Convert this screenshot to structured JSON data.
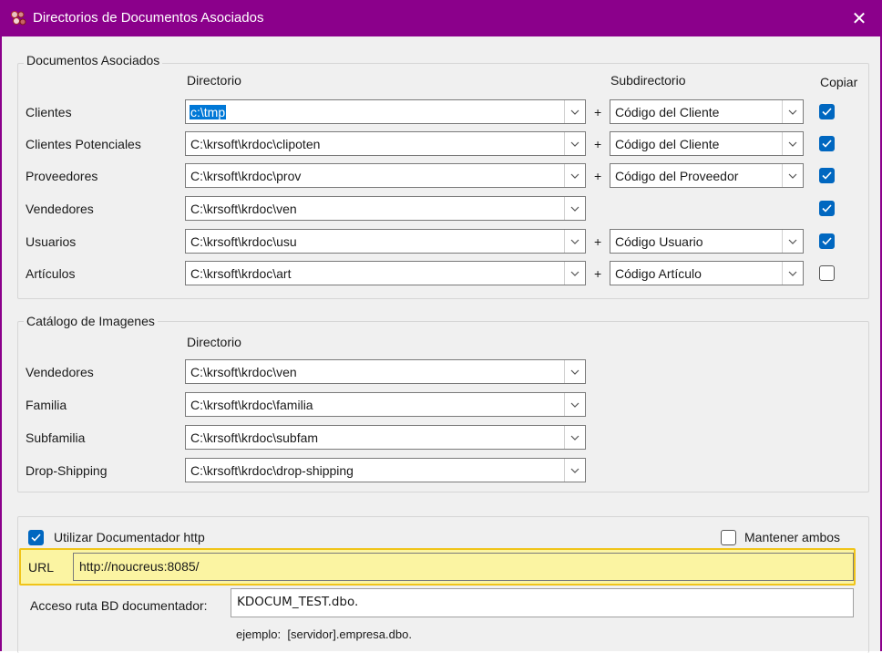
{
  "window": {
    "title": "Directorios de Documentos Asociados",
    "close_glyph": "✕",
    "accent_color": "#8b008b"
  },
  "docs": {
    "legend": "Documentos Asociados",
    "col_directorio": "Directorio",
    "col_subdirectorio": "Subdirectorio",
    "col_copiar": "Copiar",
    "plus": "+",
    "rows": [
      {
        "label": "Clientes",
        "dir": "c:\\tmp",
        "sub": "Código del Cliente",
        "copiar": true
      },
      {
        "label": "Clientes Potenciales",
        "dir": "C:\\krsoft\\krdoc\\clipoten",
        "sub": "Código del Cliente",
        "copiar": true
      },
      {
        "label": "Proveedores",
        "dir": "C:\\krsoft\\krdoc\\prov",
        "sub": "Código del Proveedor",
        "copiar": true
      },
      {
        "label": "Vendedores",
        "dir": "C:\\krsoft\\krdoc\\ven",
        "sub": "",
        "copiar": true
      },
      {
        "label": "Usuarios",
        "dir": "C:\\krsoft\\krdoc\\usu",
        "sub": "Código Usuario",
        "copiar": true
      },
      {
        "label": "Artículos",
        "dir": "C:\\krsoft\\krdoc\\art",
        "sub": "Código Artículo",
        "copiar": false
      }
    ]
  },
  "catalog": {
    "legend": "Catálogo de Imagenes",
    "col_directorio": "Directorio",
    "rows": [
      {
        "label": "Vendedores",
        "dir": "C:\\krsoft\\krdoc\\ven"
      },
      {
        "label": "Familia",
        "dir": "C:\\krsoft\\krdoc\\familia"
      },
      {
        "label": "Subfamilia",
        "dir": "C:\\krsoft\\krdoc\\subfam"
      },
      {
        "label": "Drop-Shipping",
        "dir": "C:\\krsoft\\krdoc\\drop-shipping"
      }
    ]
  },
  "http": {
    "use_label": "Utilizar Documentador http",
    "use_checked": true,
    "keep_label": "Mantener ambos",
    "keep_checked": false,
    "url_label": "URL",
    "url_value": "http://noucreus:8085/",
    "db_label": "Acceso ruta BD documentador:",
    "db_value": "KDOCUM_TEST.dbo.",
    "example": "ejemplo:  [servidor].empresa.dbo."
  },
  "icons": {
    "app": "app-icon",
    "close": "close-icon",
    "dropdown": "chevron-down-icon",
    "check": "checkmark-icon"
  }
}
